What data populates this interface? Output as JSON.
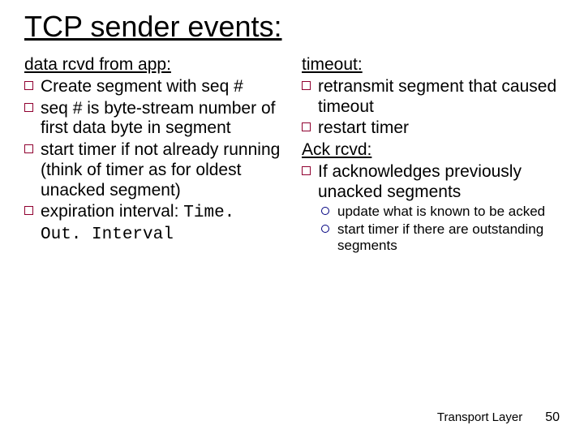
{
  "title": "TCP sender events:",
  "left": {
    "heading": "data rcvd from app:",
    "items": [
      "Create segment with seq #",
      "seq # is byte-stream number of first data byte in  segment",
      "start timer if not already running (think of timer as for oldest unacked segment)",
      "expiration interval:"
    ],
    "mono": "Time. Out. Interval"
  },
  "right": {
    "heading1": "timeout:",
    "items1": [
      "retransmit segment that caused timeout",
      "restart timer"
    ],
    "heading2": "Ack rcvd:",
    "items2": [
      "If acknowledges previously unacked segments"
    ],
    "subitems": [
      "update what is known to be acked",
      "start timer if there are outstanding segments"
    ]
  },
  "footer": {
    "label": "Transport Layer",
    "page": "50"
  }
}
